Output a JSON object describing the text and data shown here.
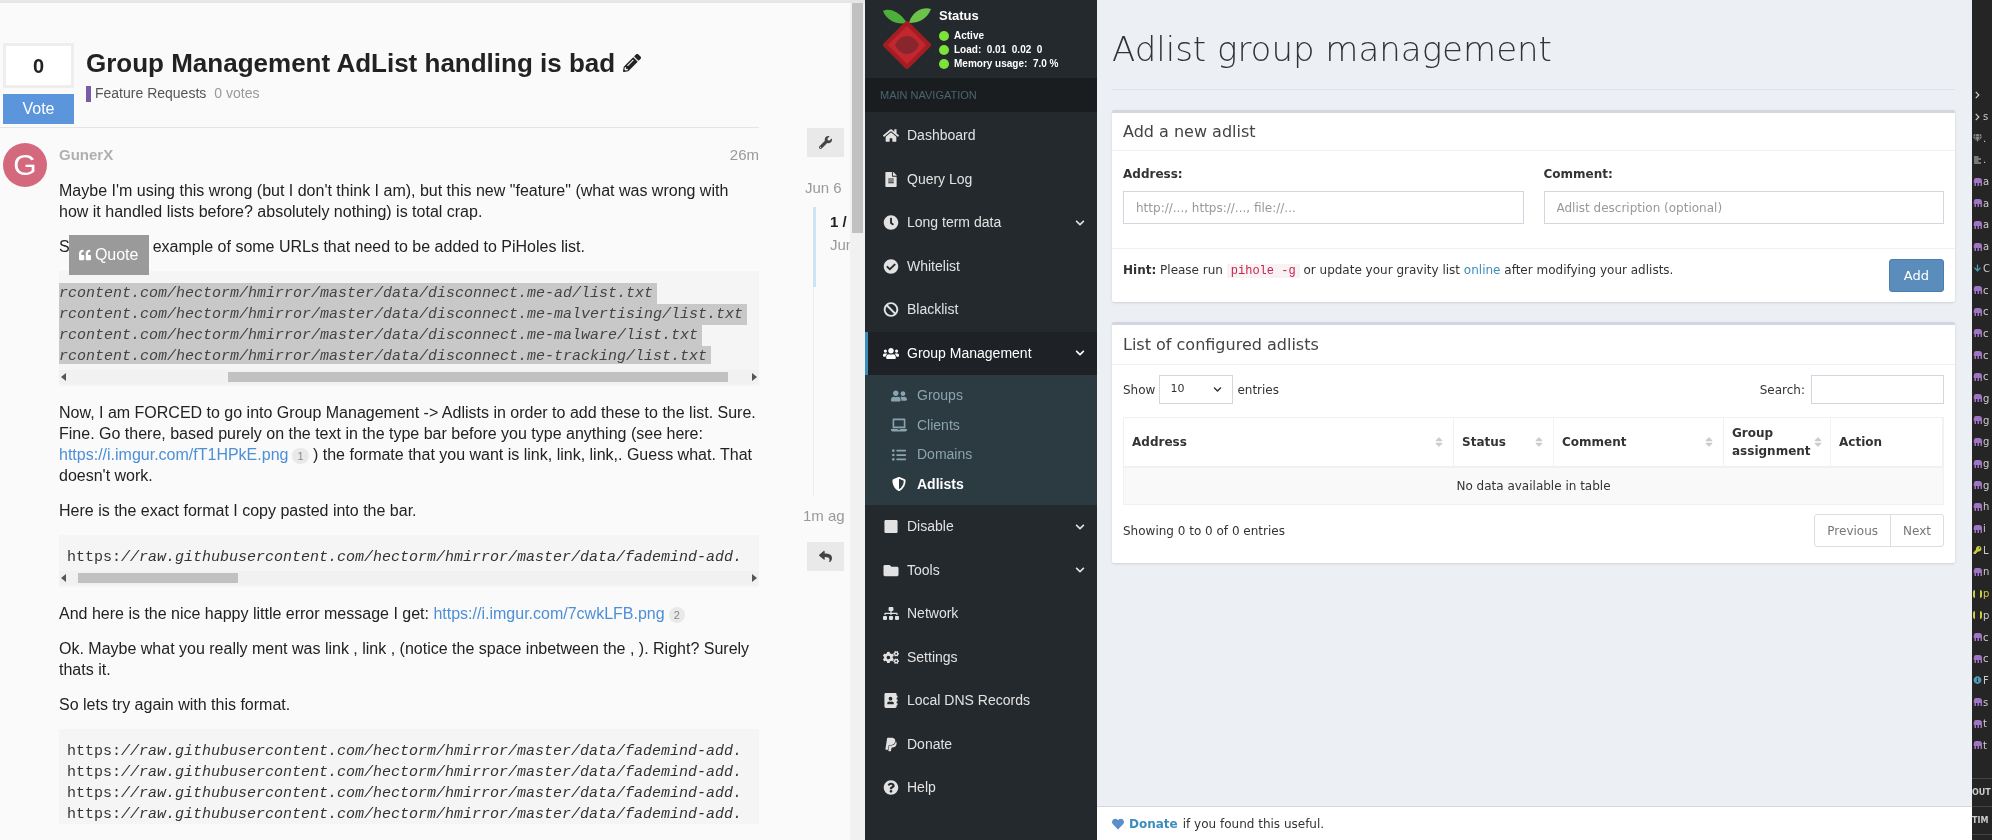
{
  "forum": {
    "votes": "0",
    "vote_button": "Vote",
    "title": "Group Management AdList handling is bad",
    "category": {
      "name": "Feature Requests",
      "color": "#7b5aa6"
    },
    "vote_count": "0 votes",
    "post": {
      "avatar_letter": "G",
      "username": "GunerX",
      "time": "26m",
      "quote_button": "Quote",
      "blocks": [
        {
          "kind": "paragraph",
          "parts": [
            {
              "text": "Maybe I'm using this wrong (but I don't think I am), but this new \"feature\" (what was wrong with how it handled lists before? absolutely nothing) is total crap."
            }
          ]
        },
        {
          "kind": "quoted_paragraph",
          "before": "S",
          "after": "example of some URLs that need to be added to PiHoles list."
        },
        {
          "kind": "code",
          "selected": true,
          "lines": [
            "rcontent.com/hectorm/hmirror/master/data/disconnect.me-ad/list.txt",
            "rcontent.com/hectorm/hmirror/master/data/disconnect.me-malvertising/list.txt",
            "rcontent.com/hectorm/hmirror/master/data/disconnect.me-malware/list.txt",
            "rcontent.com/hectorm/hmirror/master/data/disconnect.me-tracking/list.txt"
          ]
        },
        {
          "kind": "paragraph",
          "parts": [
            {
              "text": "Now, I am FORCED to go into Group Management -> Adlists in order to add these to the list. Sure. Fine. Go there, based purely on the text in the type bar before you type anything (see here: "
            },
            {
              "link": "https://i.imgur.com/fT1HPkE.png",
              "count": "1"
            },
            {
              "text": " ) the formate that you want is link, link, link,. Guess what. That doesn't work."
            }
          ]
        },
        {
          "kind": "paragraph",
          "parts": [
            {
              "text": "Here is the exact format I copy pasted into the bar."
            }
          ]
        },
        {
          "kind": "code",
          "selected": false,
          "lines": [
            "https:*//raw.githubusercontent.com/hectorm/hmirror/master/data/fademind-add.*"
          ]
        },
        {
          "kind": "paragraph",
          "parts": [
            {
              "text": "And here is the nice happy little error message I get: "
            },
            {
              "link": "https://i.imgur.com/7cwkLFB.png",
              "count": "2"
            }
          ]
        },
        {
          "kind": "paragraph",
          "parts": [
            {
              "text": "Ok. Maybe what you really ment was link , link , (notice the space inbetween the , ). Right? Surely thats it."
            }
          ]
        },
        {
          "kind": "paragraph",
          "parts": [
            {
              "text": "So lets try again with this format."
            }
          ]
        },
        {
          "kind": "code",
          "selected": false,
          "lines": [
            "https:*//raw.githubusercontent.com/hectorm/hmirror/master/data/fademind-add.*",
            "https:*//raw.githubusercontent.com/hectorm/hmirror/master/data/fademind-add.*",
            "https:*//raw.githubusercontent.com/hectorm/hmirror/master/data/fademind-add.*",
            "https:*//raw.githubusercontent.com/hectorm/hmirror/master/data/fademind-add.*"
          ]
        }
      ]
    },
    "timeline": {
      "start_date": "Jun 6",
      "position": "1 /",
      "position_date": "Jun",
      "last_activity": "1m ag"
    }
  },
  "sidebar": {
    "status": {
      "title": "Status",
      "lines": [
        {
          "text": "Active",
          "color": "#7ce33a"
        },
        {
          "text": "Load:  0.01  0.02  0",
          "color": "#7ce33a"
        },
        {
          "text": "Memory usage:  7.0 %",
          "color": "#7ce33a"
        }
      ]
    },
    "section": "MAIN NAVIGATION",
    "items": [
      {
        "label": "Dashboard",
        "selected": false,
        "has_submenu": false
      },
      {
        "label": "Query Log",
        "selected": false,
        "has_submenu": false
      },
      {
        "label": "Long term data",
        "selected": false,
        "has_submenu": true
      },
      {
        "label": "Whitelist",
        "selected": false,
        "has_submenu": false
      },
      {
        "label": "Blacklist",
        "selected": false,
        "has_submenu": false
      },
      {
        "label": "Group Management",
        "selected": true,
        "has_submenu": true,
        "children": [
          {
            "label": "Groups",
            "selected": false
          },
          {
            "label": "Clients",
            "selected": false
          },
          {
            "label": "Domains",
            "selected": false
          },
          {
            "label": "Adlists",
            "selected": true
          }
        ]
      },
      {
        "label": "Disable",
        "selected": false,
        "has_submenu": true
      },
      {
        "label": "Tools",
        "selected": false,
        "has_submenu": true
      },
      {
        "label": "Network",
        "selected": false,
        "has_submenu": false
      },
      {
        "label": "Settings",
        "selected": false,
        "has_submenu": false
      },
      {
        "label": "Local DNS Records",
        "selected": false,
        "has_submenu": false
      },
      {
        "label": "Donate",
        "selected": false,
        "has_submenu": false
      },
      {
        "label": "Help",
        "selected": false,
        "has_submenu": false
      }
    ]
  },
  "main": {
    "title": "Adlist group management",
    "add_box": {
      "title": "Add a new adlist",
      "address": {
        "label": "Address:",
        "placeholder": "http://..., https://..., file://..."
      },
      "comment": {
        "label": "Comment:",
        "placeholder": "Adlist description (optional)"
      },
      "hint": {
        "label": "Hint:",
        "before": "Please run",
        "command": "pihole -g",
        "middle": "or update your gravity list",
        "link": "online",
        "after": "after modifying your adlists."
      },
      "add_button": "Add"
    },
    "list_box": {
      "title": "List of configured adlists",
      "show": "Show",
      "page_size": "10",
      "entries": "entries",
      "search": "Search:",
      "columns": [
        {
          "label": "Address",
          "sortable": true
        },
        {
          "label": "Status",
          "sortable": true
        },
        {
          "label": "Comment",
          "sortable": true
        },
        {
          "label": "Group assignment",
          "sortable": true
        },
        {
          "label": "Action",
          "sortable": false
        }
      ],
      "empty": "No data available in table",
      "info": "Showing 0 to 0 of 0 entries",
      "pagination": [
        "Previous",
        "Next"
      ]
    },
    "footer": {
      "link": "Donate",
      "text": "if you found this useful."
    }
  },
  "explorer": {
    "items": [
      {
        "kind": "chevron"
      },
      {
        "kind": "chevron",
        "text": "s"
      },
      {
        "kind": "diamond",
        "text": "."
      },
      {
        "kind": "lines",
        "text": "."
      },
      {
        "kind": "elephant",
        "text": "a"
      },
      {
        "kind": "elephant",
        "text": "a"
      },
      {
        "kind": "elephant",
        "text": "a"
      },
      {
        "kind": "elephant",
        "text": "a"
      },
      {
        "kind": "arrow",
        "text": "C"
      },
      {
        "kind": "elephant",
        "text": "c"
      },
      {
        "kind": "elephant",
        "text": "c"
      },
      {
        "kind": "elephant",
        "text": "c"
      },
      {
        "kind": "elephant",
        "text": "c"
      },
      {
        "kind": "elephant",
        "text": "c"
      },
      {
        "kind": "elephant",
        "text": "g"
      },
      {
        "kind": "elephant",
        "text": "g"
      },
      {
        "kind": "elephant",
        "text": "g"
      },
      {
        "kind": "elephant",
        "text": "g"
      },
      {
        "kind": "elephant",
        "text": "g"
      },
      {
        "kind": "elephant",
        "text": "h"
      },
      {
        "kind": "elephant",
        "text": "i"
      },
      {
        "kind": "key",
        "text": "L"
      },
      {
        "kind": "elephant",
        "text": "n"
      },
      {
        "kind": "braces",
        "text": "p"
      },
      {
        "kind": "braces",
        "text": "p"
      },
      {
        "kind": "elephant",
        "text": "c"
      },
      {
        "kind": "elephant",
        "text": "c"
      },
      {
        "kind": "info",
        "text": "F"
      },
      {
        "kind": "elephant",
        "text": "s"
      },
      {
        "kind": "elephant",
        "text": "t"
      },
      {
        "kind": "elephant",
        "text": "t"
      }
    ],
    "panels": [
      "OUT",
      "TIM"
    ]
  }
}
